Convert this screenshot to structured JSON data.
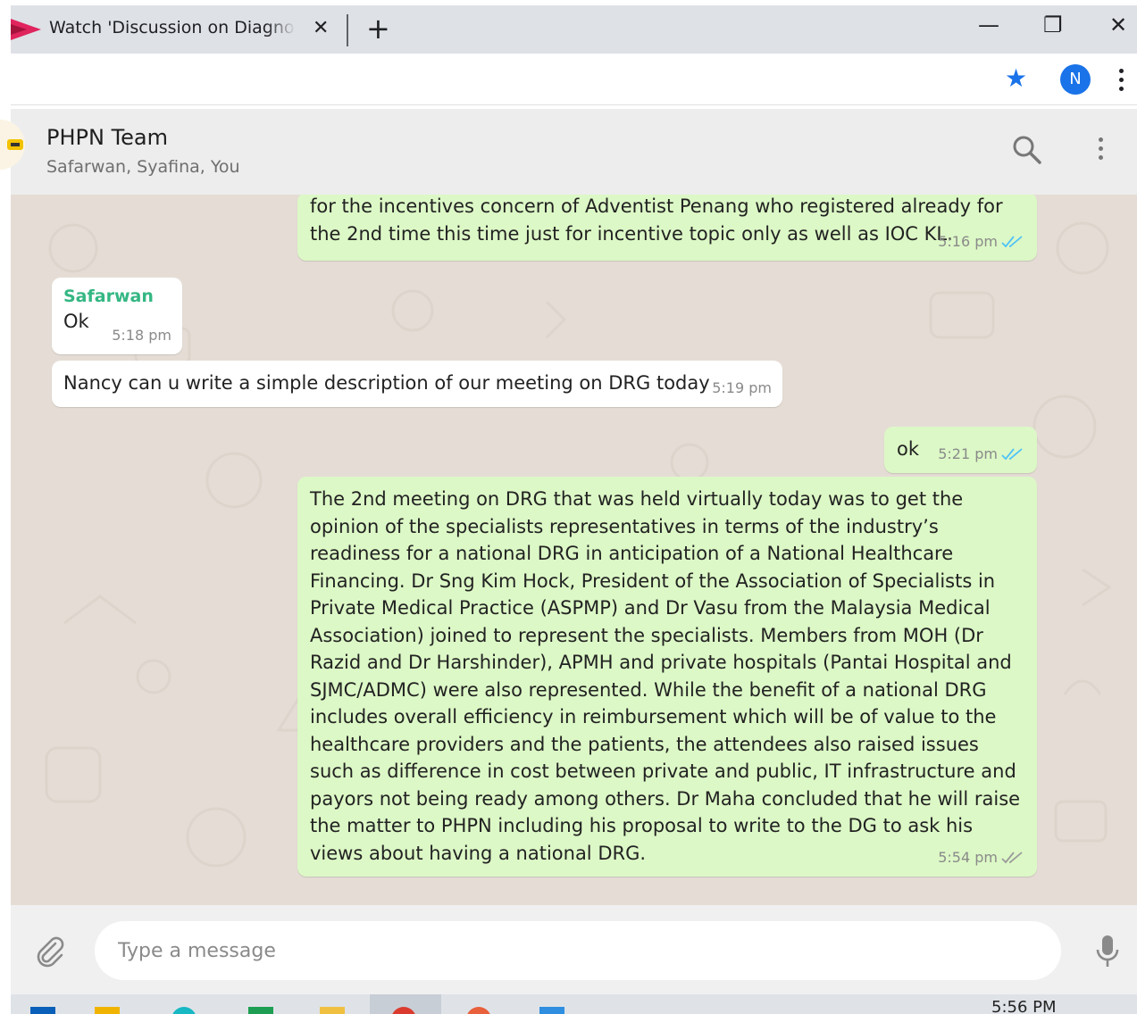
{
  "browser": {
    "tab_title": "Watch 'Discussion on Diagnosis-related",
    "tab_close": "✕",
    "new_tab": "+",
    "window_controls": {
      "minimize": "—",
      "restore": "❐",
      "close": "✕"
    },
    "profile_initial": "N",
    "bookmark_icon": "star-icon",
    "colors": {
      "accent": "#1a73e8",
      "tab_strip": "#dee1e6"
    }
  },
  "chat": {
    "name": "PHPN Team",
    "members": "Safarwan, Syafina, You",
    "colors": {
      "outgoing_bubble": "#dcf8c6",
      "incoming_bubble": "#ffffff",
      "wallpaper": "#e5ddd5",
      "sender_name": "#35b783",
      "read_ticks": "#4fc3f7"
    }
  },
  "messages": [
    {
      "direction": "out",
      "text": "for the incentives concern of Adventist Penang who registered already for the 2nd time this time just for incentive topic only as well as IOC KL.",
      "time": "5:16 pm",
      "status": "read"
    },
    {
      "direction": "in",
      "sender": "Safarwan",
      "text": "Ok",
      "time": "5:18 pm"
    },
    {
      "direction": "in",
      "text": "Nancy can u write a simple description of our meeting on DRG today",
      "time": "5:19 pm"
    },
    {
      "direction": "out",
      "text": "ok",
      "time": "5:21 pm",
      "status": "read"
    },
    {
      "direction": "out",
      "text": "The 2nd meeting on DRG that was held virtually today was to get the opinion of the specialists representatives in terms of the industry’s readiness for a national DRG in anticipation of a National Healthcare Financing. Dr Sng Kim Hock, President of the Association of Specialists in Private Medical Practice (ASPMP) and Dr Vasu from the Malaysia Medical Association) joined to represent the specialists. Members from MOH (Dr Razid and Dr Harshinder), APMH and private hospitals (Pantai Hospital and SJMC/ADMC) were also represented. While the benefit of a national DRG includes overall efficiency in reimbursement which will be of value to the healthcare providers and the patients, the attendees also raised issues such as difference in cost between private and public, IT infrastructure and payors not being ready among others. Dr Maha concluded that he will raise the matter to PHPN including his proposal to write to the DG to ask his views about having a national DRG.",
      "time": "5:54 pm",
      "status": "delivered"
    }
  ],
  "composer": {
    "placeholder": "Type a message"
  },
  "taskbar": {
    "time": "5:56 PM"
  }
}
